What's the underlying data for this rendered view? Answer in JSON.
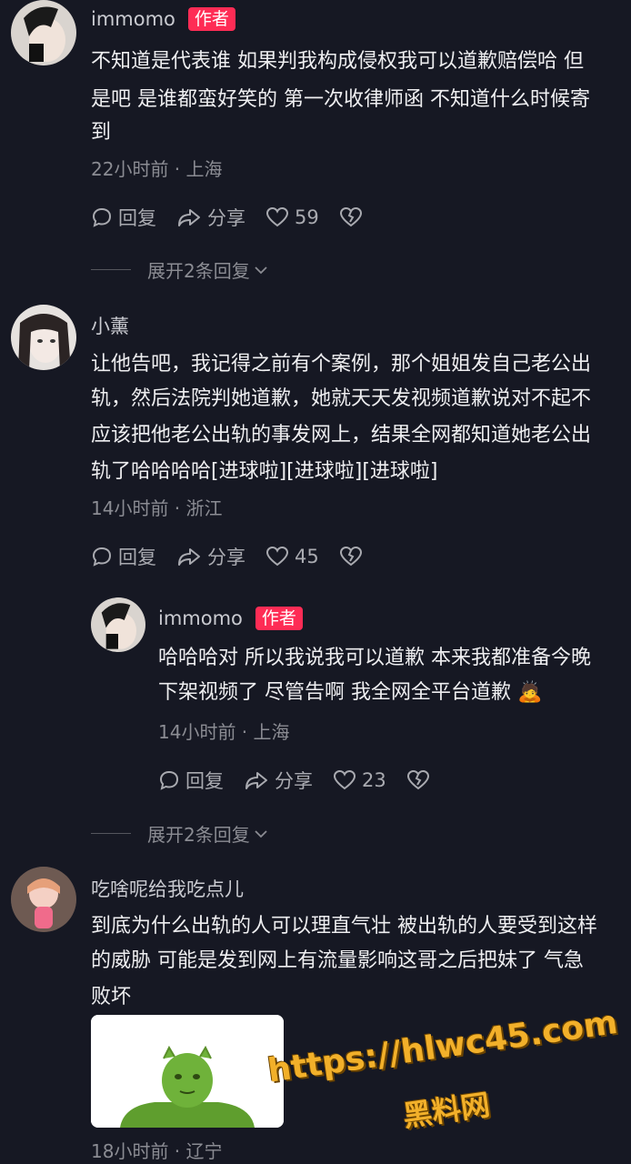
{
  "comments": [
    {
      "username": "immomo",
      "author_tag": "作者",
      "lines": [
        "不知道是代表谁 如果判我构成侵权我可以道歉赔偿哈 但",
        "是吧 是谁都蛮好笑的 第一次收律师函 不知道什么时候寄",
        "到"
      ],
      "meta": "22小时前 · 上海",
      "reply_label": "回复",
      "share_label": "分享",
      "likes": "59",
      "expand_label": "展开2条回复"
    },
    {
      "username": "小薰",
      "lines": [
        "让他告吧，我记得之前有个案例，那个姐姐发自己老公出",
        "轨，然后法院判她道歉，她就天天发视频道歉说对不起不",
        "应该把他老公出轨的事发网上，结果全网都知道她老公出",
        "轨了哈哈哈哈[进球啦][进球啦][进球啦]"
      ],
      "meta": "14小时前 · 浙江",
      "reply_label": "回复",
      "share_label": "分享",
      "likes": "45"
    },
    {
      "username": "immomo",
      "author_tag": "作者",
      "lines": [
        "哈哈哈对 所以我说我可以道歉 本来我都准备今晚",
        "下架视频了 尽管告啊 我全网全平台道歉 🙇"
      ],
      "meta": "14小时前 · 上海",
      "reply_label": "回复",
      "share_label": "分享",
      "likes": "23",
      "expand_label": "展开2条回复"
    },
    {
      "username": "吃啥呢给我吃点儿",
      "lines": [
        "到底为什么出轨的人可以理直气壮 被出轨的人要受到这样",
        "的威胁 可能是发到网上有流量影响这哥之后把妹了 气急",
        "败坏"
      ],
      "meta": "18小时前 · 辽宁"
    }
  ],
  "watermark": {
    "url": "https://hlwc45.com",
    "name": "黑料网"
  },
  "colors": {
    "background": "#161823",
    "author_tag": "#fe2c55",
    "watermark": "#f2b02a"
  }
}
